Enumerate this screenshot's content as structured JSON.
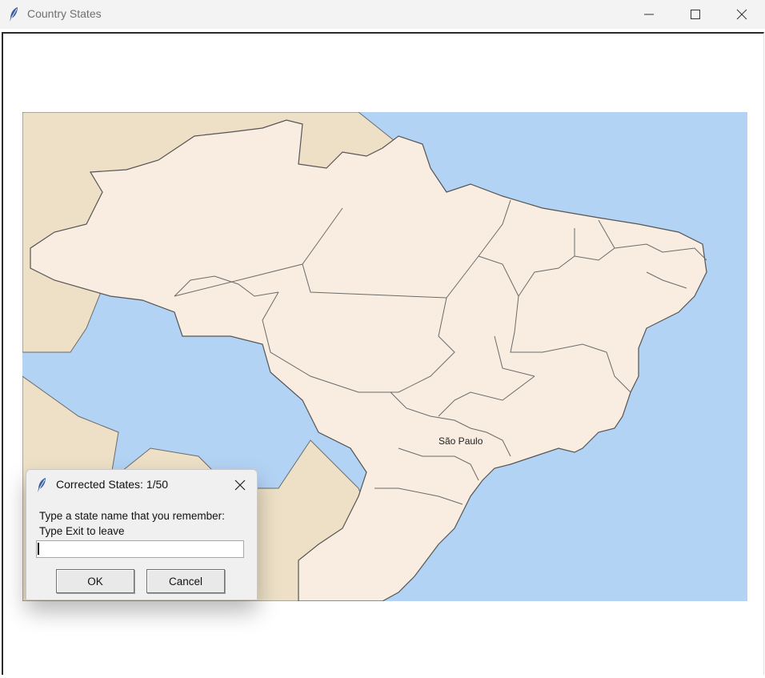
{
  "window": {
    "title": "Country States",
    "controls": {
      "minimize": "minimize-icon",
      "maximize": "maximize-icon",
      "close": "close-icon"
    }
  },
  "map": {
    "labels": [
      {
        "text": "São Paulo"
      }
    ],
    "colors": {
      "ocean": "#b3d3f5",
      "brazil_states": "#f8ede0",
      "neighbors": "#ede0c6",
      "borders": "#6b6b6b"
    }
  },
  "dialog": {
    "title": "Corrected States: 1/50",
    "prompt_line1": "Type a state name that you remember:",
    "prompt_line2": "Type Exit to leave",
    "input_value": "",
    "ok_label": "OK",
    "cancel_label": "Cancel"
  }
}
